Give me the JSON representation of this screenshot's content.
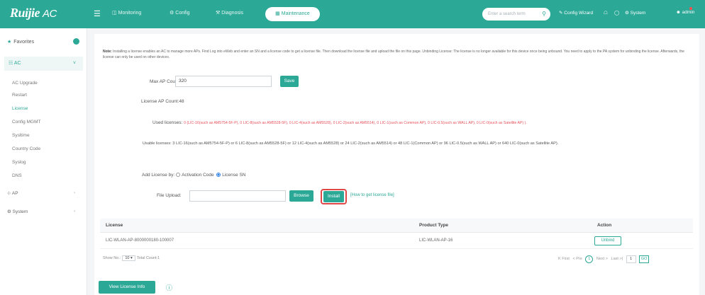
{
  "header": {
    "logo": "Ruijie",
    "product": "AC",
    "nav": [
      {
        "label": "Monitoring",
        "icon": "monitor-icon"
      },
      {
        "label": "Config",
        "icon": "gear-icon"
      },
      {
        "label": "Diagnosis",
        "icon": "diagnosis-icon"
      }
    ],
    "active_nav": "Maintenance",
    "search_placeholder": "Enter a search term",
    "config_wizard": "Config Wizard",
    "system": "System",
    "user": "admin"
  },
  "sidebar": {
    "favorites": "Favorites",
    "ac_group": "AC",
    "ac_items": [
      "AC Upgrade",
      "Restart",
      "License",
      "Config MGMT",
      "Sysltime",
      "Country Code",
      "Syslog",
      "DNS"
    ],
    "active_item": "License",
    "groups": [
      "AP",
      "System"
    ]
  },
  "content": {
    "note_label": "Note:",
    "note_text": "Installing a license enables an AC to manage more APs. Find Log into eWeb and enter an SN and a license code to get a license file. Then download the license file and upload the file on this page. Unbinding License: The license is no longer available for this device once being unbound. You need to apply to the PA system for unbinding the license. Afterwards, the license can only be used on other devices.",
    "max_ap_label": "Max AP Count:",
    "max_ap_value": "320",
    "save_label": "Save",
    "license_ap_count": "License AP Count:48",
    "used_label": "Used licenses:",
    "used_value": "0 (LIC-16(such as AM5754-5F-P), 0 LIC-8(such as AM5528-5F), 0 LIC-4(such as AM5528), 0 LIC-2(such as AM5514), 0 LIC-1(such as Common AP), 0 LIC-0.5(such as WALL AP), 0 LIC-0(such as Satellite AP) ).",
    "usable_label": "Usable licenses:",
    "usable_value": "3 LIC-16(such as AM5754-5F-P) or 6 LIC-8(such as AM5528-5F) or 12 LIC-4(such as AM5528) or 24 LIC-2(such as AM5514) or 48 LIC-1(Common AP) or 96 LIC-0.5(such as WALL AP) or 640 LIC-0(such as Satellite AP).",
    "add_license_label": "Add License by:",
    "option_activation": "Activation Code",
    "option_sn": "License SN",
    "file_upload_label": "File Upload:",
    "browse_label": "Browse",
    "install_label": "Install",
    "help_link": "[How to get license file]"
  },
  "table": {
    "columns": [
      "License",
      "Product Type",
      "Action"
    ],
    "rows": [
      {
        "license": "LIC-WLAN-AP-8000000180-100007",
        "product_type": "LIC-WLAN-AP-16",
        "action": "Unbind"
      }
    ]
  },
  "pagination": {
    "show_label": "Show No.:",
    "page_size": "10",
    "total_count": "Total Count:1",
    "first": "K First",
    "prev": "< Pre",
    "current_page": "1",
    "next": "Next >",
    "last": "Last >|",
    "goto_value": "1",
    "go_label": "GO"
  },
  "footer": {
    "view_license_info": "View License Info"
  },
  "colors": {
    "brand": "#2ba896",
    "highlight": "#e04848",
    "used_licenses": "#e8525b"
  }
}
